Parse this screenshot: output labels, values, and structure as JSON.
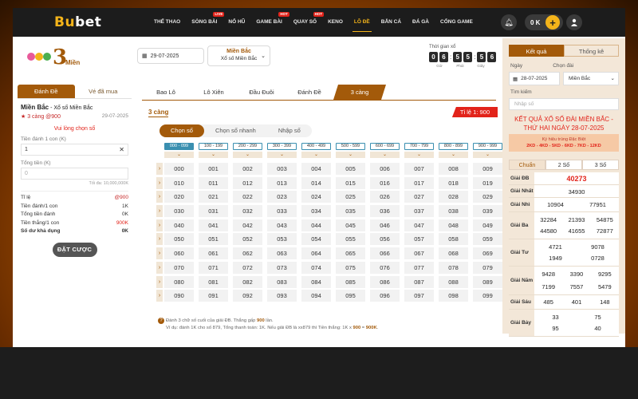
{
  "brand": {
    "logo_a": "Bu",
    "logo_b": "bet"
  },
  "nav": [
    {
      "label": "THỂ THAO",
      "badge": ""
    },
    {
      "label": "SÒNG BÀI",
      "badge": "LIVE"
    },
    {
      "label": "NỔ HŨ",
      "badge": ""
    },
    {
      "label": "GAME BÀI",
      "badge": "HOT"
    },
    {
      "label": "QUAY SỐ",
      "badge": "HOT"
    },
    {
      "label": "KENO",
      "badge": ""
    },
    {
      "label": "LÔ ĐỀ",
      "badge": ""
    },
    {
      "label": "BẮN CÁ",
      "badge": ""
    },
    {
      "label": "ĐÁ GÀ",
      "badge": ""
    },
    {
      "label": "CỔNG GAME",
      "badge": ""
    }
  ],
  "header": {
    "balance": "0 K",
    "plus": "+"
  },
  "selector": {
    "logo_number": "3",
    "logo_text": "Miền",
    "date": "29-07-2025",
    "region_title": "Miền Bắc",
    "region_sub": "Xổ số Miền Bắc",
    "countdown_label": "Thời gian xổ",
    "countdown_digits": [
      "0",
      "6",
      "5",
      "5",
      "5",
      "6"
    ],
    "countdown_units": [
      "Giờ",
      "Phút",
      "Giây"
    ]
  },
  "left": {
    "tab_bet": "Đánh Đề",
    "tab_bought": "Vé đã mua",
    "region": "Miền Bắc",
    "region_sub": " - Xổ số Miền Bắc",
    "game": "★ 3 càng @900",
    "date": "29-07-2025",
    "warning": "Vui lòng chọn số",
    "unit_label": "Tiền đánh 1 con (K)",
    "unit_value": "1",
    "clear": "✕",
    "total_label": "Tổng tiền (K)",
    "total_value": "0",
    "max": "Tối đa: 10,000,000K",
    "summary": [
      {
        "label": "Tỉ lệ",
        "value": "@900"
      },
      {
        "label": "Tiền đánh/1 con",
        "value": "1K"
      },
      {
        "label": "Tổng tiền đánh",
        "value": "0K"
      },
      {
        "label": "Tiền thắng/1 con",
        "value": "900K"
      },
      {
        "label": "Số dư khả dụng",
        "value": "0K"
      }
    ],
    "bet_button": "ĐẶT CƯỢC"
  },
  "center": {
    "tabs": [
      "Bao Lô",
      "Lô Xiên",
      "Đầu Đuôi",
      "Đánh Đề",
      "3 càng"
    ],
    "game_name": "3 càng",
    "ratio": "Tỉ lệ 1: 900",
    "modes": [
      "Chọn số",
      "Chọn số nhanh",
      "Nhập số"
    ],
    "ranges": [
      "000 - 099",
      "100 - 199",
      "200 - 299",
      "300 - 399",
      "400 - 499",
      "500 - 599",
      "600 - 699",
      "700 - 799",
      "800 - 899",
      "900 - 999"
    ],
    "arrow": "›",
    "chevron": "⌄",
    "grid": [
      [
        "000",
        "001",
        "002",
        "003",
        "004",
        "005",
        "006",
        "007",
        "008",
        "009"
      ],
      [
        "010",
        "011",
        "012",
        "013",
        "014",
        "015",
        "016",
        "017",
        "018",
        "019"
      ],
      [
        "020",
        "021",
        "022",
        "023",
        "024",
        "025",
        "026",
        "027",
        "028",
        "029"
      ],
      [
        "030",
        "031",
        "032",
        "033",
        "034",
        "035",
        "036",
        "037",
        "038",
        "039"
      ],
      [
        "040",
        "041",
        "042",
        "043",
        "044",
        "045",
        "046",
        "047",
        "048",
        "049"
      ],
      [
        "050",
        "051",
        "052",
        "053",
        "054",
        "055",
        "056",
        "057",
        "058",
        "059"
      ],
      [
        "060",
        "061",
        "062",
        "063",
        "064",
        "065",
        "066",
        "067",
        "068",
        "069"
      ],
      [
        "070",
        "071",
        "072",
        "073",
        "074",
        "075",
        "076",
        "077",
        "078",
        "079"
      ],
      [
        "080",
        "081",
        "082",
        "083",
        "084",
        "085",
        "086",
        "087",
        "088",
        "089"
      ],
      [
        "090",
        "091",
        "092",
        "093",
        "094",
        "095",
        "096",
        "097",
        "098",
        "099"
      ]
    ],
    "note_line1_a": "Đánh 3 chữ số cuối của giải ĐB. Thắng gấp ",
    "note_line1_b": "900",
    "note_line1_c": " lần.",
    "note_line2_a": "Ví dụ: đánh 1K cho số 879, Tổng thanh toán: 1K. Nếu giải ĐB là xx879 thì Tiền thắng: 1K x ",
    "note_line2_b": "900",
    "note_line2_c": " = ",
    "note_line2_d": "900K",
    "note_line2_e": "."
  },
  "right": {
    "tab_results": "Kết quả",
    "tab_stats": "Thống kê",
    "date_label": "Ngày",
    "region_label": "Chọn đài",
    "date": "28-07-2025",
    "region": "Miền Bắc",
    "search_label": "Tìm kiếm",
    "search_placeholder": "Nhập số",
    "title": "KẾT QUẢ XỔ SỐ ĐÀI MIỀN BẮC - THỨ HAI NGÀY 28-07-2025",
    "special_label": "Ký hiệu trúng Đặc Biệt",
    "special_codes": "2KD - 4KD - 5KD - 6KD - 7KD - 12KD",
    "digit_tabs": [
      "Chuẩn",
      "2 Số",
      "3 Số"
    ],
    "rows": [
      {
        "label": "Giải ĐB",
        "values": [
          "40273"
        ],
        "special": true
      },
      {
        "label": "Giải Nhất",
        "values": [
          "34930"
        ]
      },
      {
        "label": "Giải Nhì",
        "values": [
          "10904",
          "77951"
        ]
      },
      {
        "label": "Giải Ba",
        "values": [
          "32284",
          "21393",
          "54875",
          "44580",
          "41655",
          "72877"
        ]
      },
      {
        "label": "Giải Tư",
        "values": [
          "4721",
          "9078",
          "1949",
          "0728"
        ]
      },
      {
        "label": "Giải Năm",
        "values": [
          "9428",
          "3390",
          "9295",
          "7199",
          "7557",
          "5479"
        ]
      },
      {
        "label": "Giải Sáu",
        "values": [
          "485",
          "401",
          "148"
        ]
      },
      {
        "label": "Giải Bảy",
        "values": [
          "33",
          "75",
          "95",
          "40"
        ]
      }
    ]
  },
  "colors": {
    "accent": "#a35a0a",
    "gold": "#f4b41a",
    "red": "#e2231a",
    "range_blue": "#3a8fb0"
  }
}
